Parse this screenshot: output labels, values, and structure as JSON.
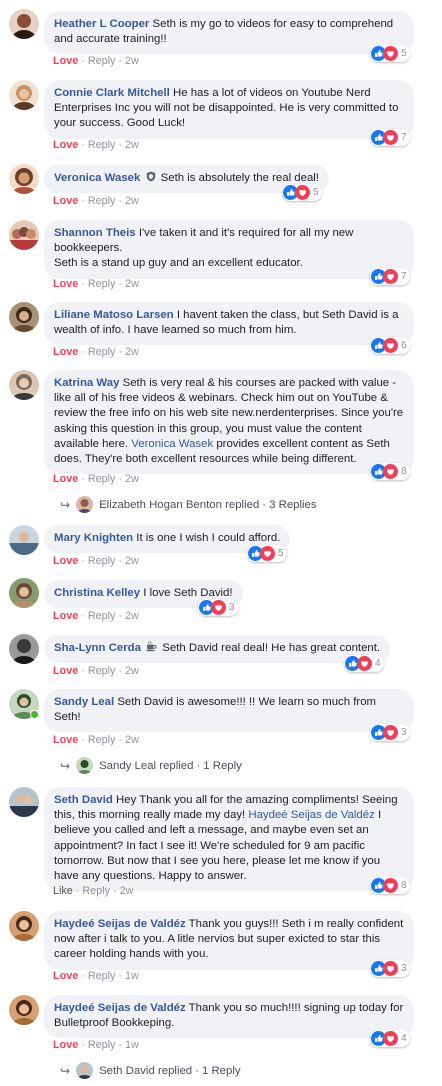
{
  "comments": [
    {
      "name": "Heather L Cooper",
      "text": "Seth is my go to videos for easy to comprehend and accurate training!!",
      "action": "Love",
      "reply": "Reply",
      "time": "2w",
      "count": "5",
      "colors": [
        "#8a4b38",
        "#2c1a12"
      ]
    },
    {
      "name": "Connie Clark Mitchell",
      "text": "He has a lot of videos on Youtube Nerd Enterprises Inc you will not be disappointed. He is very committed to your success. Good Luck!",
      "action": "Love",
      "reply": "Reply",
      "time": "2w",
      "count": "7",
      "colors": [
        "#c9945f",
        "#5a3b22"
      ]
    },
    {
      "name": "Veronica Wasek",
      "text": "Seth is absolutely the real deal!",
      "action": "Love",
      "reply": "Reply",
      "time": "2w",
      "count": "5",
      "colors": [
        "#d4a06c",
        "#6b3f2a"
      ]
    },
    {
      "name": "Shannon Theis",
      "text": "I've taken it and it's required for all my new bookkeepers.\nSeth is a stand up guy and an excellent educator.",
      "action": "Love",
      "reply": "Reply",
      "time": "2w",
      "count": "7",
      "colors": [
        "#b86b5a",
        "#e8c9b8"
      ]
    },
    {
      "name": "Liliane Matoso Larsen",
      "text": "I havent taken the class, but Seth David is a wealth of info. I have learned so much from him.",
      "action": "Love",
      "reply": "Reply",
      "time": "2w",
      "count": "6",
      "colors": [
        "#6a4a2e",
        "#3a2a1a"
      ]
    },
    {
      "name": "Katrina Way",
      "text_before": "Seth is very real & his courses are packed with value - like all of his free videos & webinars. Check him out on YouTube & review the free info on his web site new.nerdenterprises. Since you're asking this question in this group, you must value the content available here.",
      "mention": "Veronica Wasek",
      "text_after": "provides excellent content as Seth does. They're both excellent resources while being different.",
      "action": "Love",
      "reply": "Reply",
      "time": "2w",
      "count": "8",
      "colors": [
        "#7a6a5a",
        "#d9c8b6"
      ],
      "replies": {
        "name": "Elizabeth Hogan Benton",
        "verb": "replied",
        "count": "3 Replies"
      }
    },
    {
      "name": "Mary Knighten",
      "text": "It is one I wish I could afford.",
      "action": "Love",
      "reply": "Reply",
      "time": "2w",
      "count": "5",
      "colors": [
        "#4a6a8a",
        "#c9d6e0"
      ]
    },
    {
      "name": "Christina Kelley",
      "text": "I love Seth David!",
      "action": "Love",
      "reply": "Reply",
      "time": "2w",
      "count": "3",
      "colors": [
        "#6b4a3a",
        "#b8926e"
      ]
    },
    {
      "name": "Sha-Lynn Cerda",
      "text": "Seth David real deal! He has great content.",
      "action": "Love",
      "reply": "Reply",
      "time": "2w",
      "count": "4",
      "colors": [
        "#3a3a3a",
        "#9a9a9a"
      ]
    },
    {
      "name": "Sandy Leal",
      "text": "Seth David is awesome!!! !! We learn so much from Seth!",
      "action": "Love",
      "reply": "Reply",
      "time": "2w",
      "count": "3",
      "colors": [
        "#5a8a5a",
        "#2a4a2a"
      ],
      "replies": {
        "name": "Sandy Leal",
        "verb": "replied",
        "count": "1 Reply"
      }
    },
    {
      "name": "Seth David",
      "text_before": "Hey Thank you all for the amazing compliments! Seeing this, this morning really made my day!",
      "mention": "Haydeé Seijas de Valdéz",
      "text_after": "I believe you called and left a message, and maybe even set an appointment? In fact I see it! We're scheduled for 9 am pacific tomorrow. But now that I see you here, please let me know if you have any questions. Happy to answer.",
      "action": "Like",
      "reply": "Reply",
      "time": "2w",
      "count": "8",
      "colors": [
        "#6a7a8a",
        "#2a3a4a"
      ]
    },
    {
      "name": "Haydeé Seijas de Valdéz",
      "text": "Thank you guys!!! Seth i m really confident now after i talk to you. A litle nervios but super exicted to star this career holding hands with you.",
      "action": "Love",
      "reply": "Reply",
      "time": "1w",
      "count": "3",
      "colors": [
        "#a86a3a",
        "#4a2a1a"
      ]
    },
    {
      "name": "Haydeé Seijas de Valdéz",
      "text": "Thank you so much!!!! signing up today for Bulletproof Bookkeping.",
      "action": "Love",
      "reply": "Reply",
      "time": "1w",
      "count": "4",
      "colors": [
        "#a86a3a",
        "#4a2a1a"
      ],
      "replies": {
        "name": "Seth David",
        "verb": "replied",
        "count": "1 Reply"
      }
    }
  ],
  "colors": {
    "link": "#385898",
    "love": "#f33e58",
    "like_blue": "#1877f2",
    "bubble": "#f0f2f5"
  },
  "icons": {
    "reply_arrow": "reply-arrow-icon",
    "like": "like-icon",
    "love": "love-icon",
    "badge": "shield-badge-icon",
    "coffee": "coffee-icon"
  }
}
